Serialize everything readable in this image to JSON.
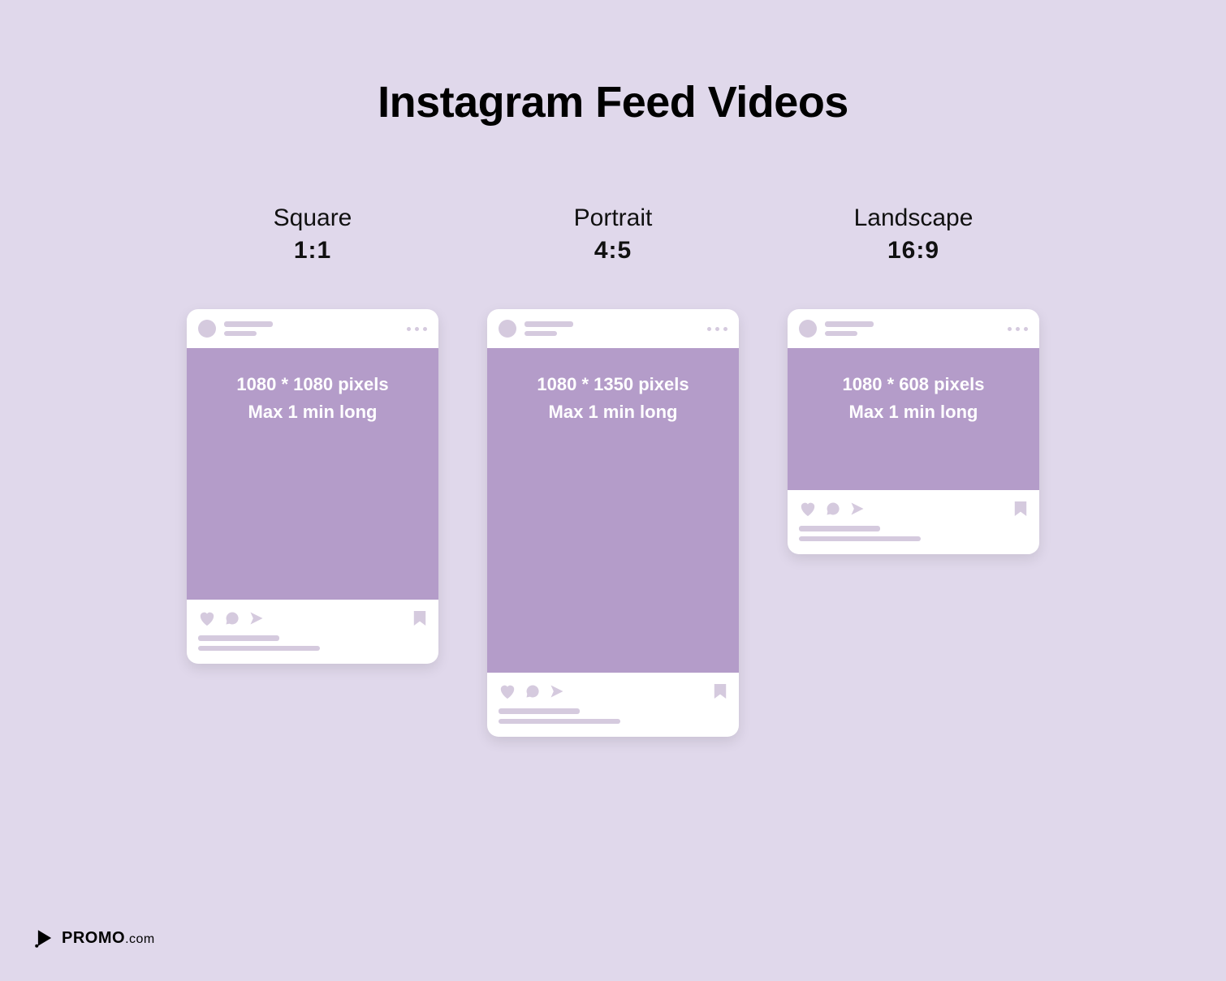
{
  "title": "Instagram Feed Videos",
  "formats": [
    {
      "name": "Square",
      "ratio": "1:1",
      "resolution": "1080 * 1080 pixels",
      "duration": "Max 1 min long"
    },
    {
      "name": "Portrait",
      "ratio": "4:5",
      "resolution": "1080 * 1350 pixels",
      "duration": "Max 1 min long"
    },
    {
      "name": "Landscape",
      "ratio": "16:9",
      "resolution": "1080 * 608 pixels",
      "duration": "Max 1 min long"
    }
  ],
  "brand": {
    "name": "PROMO",
    "suffix": ".com"
  }
}
